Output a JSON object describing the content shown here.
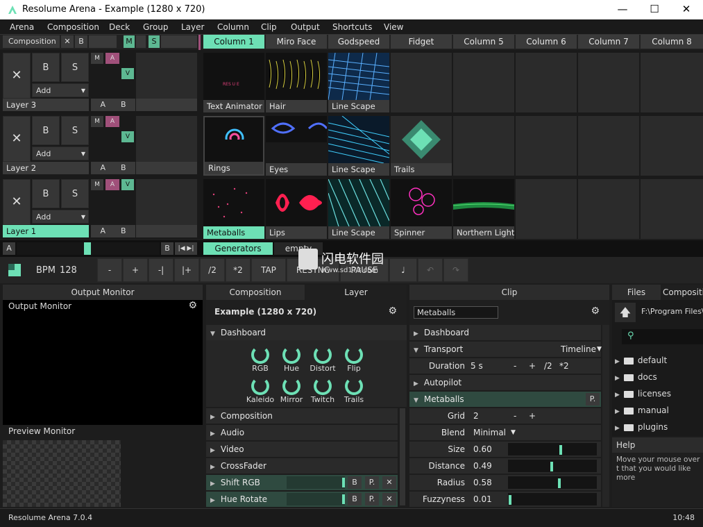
{
  "window": {
    "title": "Resolume Arena - Example (1280 x 720)",
    "min": "—",
    "max": "☐",
    "close": "✕"
  },
  "menu": [
    "Arena",
    "Composition",
    "Deck",
    "Group",
    "Layer",
    "Column",
    "Clip",
    "Output",
    "Shortcuts",
    "View"
  ],
  "composition_bar": {
    "label": "Composition",
    "x": "✕",
    "b": "B",
    "m": "M",
    "s": "S"
  },
  "columns": [
    "Column 1",
    "Miro Face",
    "Godspeed",
    "Fidget",
    "Column 5",
    "Column 6",
    "Column 7",
    "Column 8"
  ],
  "layers": [
    {
      "name": "Layer 3",
      "x": "✕",
      "b": "B",
      "s": "S",
      "add": "Add",
      "m": "M",
      "a": "A",
      "v": "V",
      "ab_a": "A",
      "ab_b": "B",
      "clips": [
        "Text Animator",
        "Hair",
        "Line Scape"
      ]
    },
    {
      "name": "Layer 2",
      "x": "✕",
      "b": "B",
      "s": "S",
      "add": "Add",
      "m": "M",
      "a": "A",
      "v": "V",
      "ab_a": "A",
      "ab_b": "B",
      "clips": [
        "Rings",
        "Eyes",
        "Line Scape",
        "Trails"
      ]
    },
    {
      "name": "Layer 1",
      "x": "✕",
      "b": "B",
      "s": "S",
      "add": "Add",
      "m": "M",
      "a": "A",
      "v": "V",
      "ab_a": "A",
      "ab_b": "B",
      "clips": [
        "Metaballs",
        "Lips",
        "Line Scape",
        "Spinner",
        "Northern Light"
      ]
    }
  ],
  "crossfader": {
    "a": "A",
    "b": "B",
    "tabs": [
      "Generators",
      "empty"
    ]
  },
  "transport": {
    "bpm_label": "BPM",
    "bpm": "128",
    "minus": "-",
    "plus": "+",
    "nudge_minus": "-|",
    "nudge_plus": "|+",
    "half": "/2",
    "double": "*2",
    "tap": "TAP",
    "resync": "RESYNC",
    "pause": "PAUSE"
  },
  "watermark": {
    "text": "闪电软件园",
    "url": "www.sd173.com"
  },
  "output_monitor": {
    "header": "Output Monitor",
    "title": "Output Monitor",
    "preview": "Preview Monitor"
  },
  "comp_panel": {
    "tabs": [
      "Composition",
      "Layer"
    ],
    "title": "Example (1280 x 720)",
    "dashboard": "Dashboard",
    "knobs": [
      "RGB",
      "Hue",
      "Distort",
      "Flip",
      "Kaleido",
      "Mirror",
      "Twitch",
      "Trails"
    ],
    "sections": [
      "Composition",
      "Audio",
      "Video",
      "CrossFader"
    ],
    "effects": [
      {
        "name": "Shift RGB",
        "b": "B",
        "p": "P.",
        "x": "✕"
      },
      {
        "name": "Hue Rotate",
        "b": "B",
        "p": "P.",
        "x": "✕"
      }
    ]
  },
  "clip_panel": {
    "header": "Clip",
    "name": "Metaballs",
    "dashboard": "Dashboard",
    "transport": "Transport",
    "timeline": "Timeline",
    "duration_label": "Duration",
    "duration": "5 s",
    "d_minus": "-",
    "d_plus": "+",
    "d_half": "/2",
    "d_double": "*2",
    "autopilot": "Autopilot",
    "metaballs": "Metaballs",
    "p": "P.",
    "grid_label": "Grid",
    "grid": "2",
    "g_minus": "-",
    "g_plus": "+",
    "blend_label": "Blend",
    "blend": "Minimal",
    "params": [
      {
        "label": "Size",
        "value": "0.60",
        "level": 0.6
      },
      {
        "label": "Distance",
        "value": "0.49",
        "level": 0.49
      },
      {
        "label": "Radius",
        "value": "0.58",
        "level": 0.58
      },
      {
        "label": "Fuzzyness",
        "value": "0.01",
        "level": 0.01
      }
    ]
  },
  "files_panel": {
    "tabs": [
      "Files",
      "Compositio"
    ],
    "path": "F:\\Program Files\\R",
    "folders": [
      "default",
      "docs",
      "licenses",
      "manual",
      "plugins"
    ],
    "help_title": "Help",
    "help_text": "Move your mouse over t that you would like more"
  },
  "status": {
    "version": "Resolume Arena 7.0.4",
    "time": "10:48"
  },
  "colors": {
    "accent": "#6de0b5",
    "pink": "#a0507a"
  }
}
